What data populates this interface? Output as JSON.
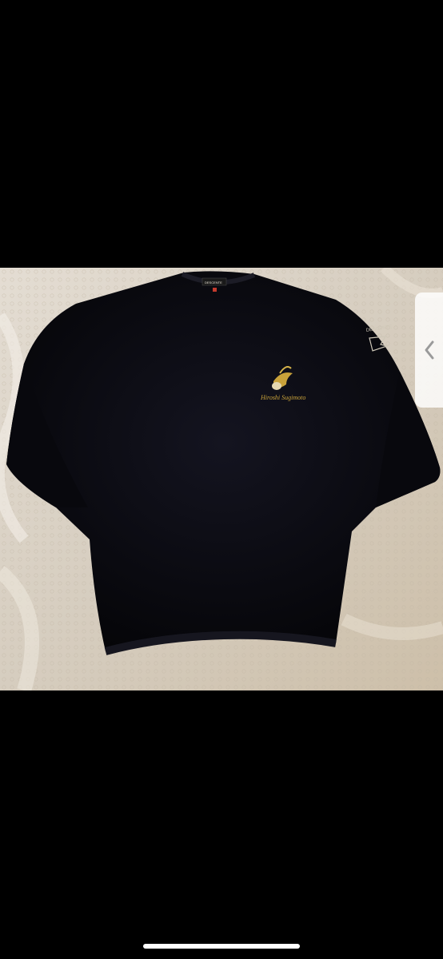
{
  "photo": {
    "alt_subject": "black crew-neck knit sweater with gold embroidered emblem",
    "background_color": "#d9d2c6",
    "garment_color": "#0a0a10",
    "emblem_color": "#c9a23a",
    "emblem_text": "Hiroshi Sugimoto",
    "neck_label_text": "DESCENTE",
    "sleeve_text": "DESCENTE"
  },
  "gallery": {
    "next_icon": "chevron-left-icon"
  },
  "colors": {
    "viewer_background": "#000000",
    "button_background": "#ffffff",
    "chevron": "#9a9a9a"
  }
}
